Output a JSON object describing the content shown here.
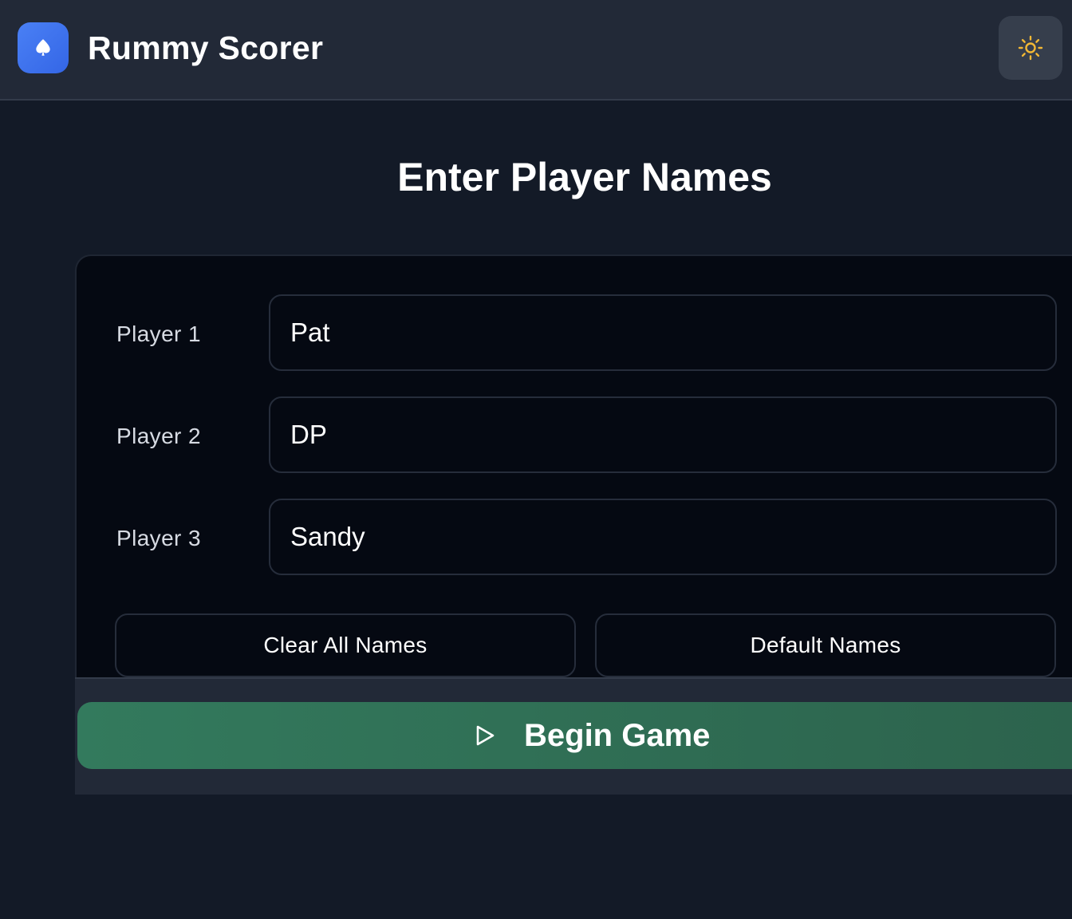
{
  "app": {
    "title": "Rummy Scorer",
    "logo_icon": "spade-icon",
    "theme_toggle_icon": "sun-icon"
  },
  "page": {
    "title": "Enter Player Names"
  },
  "players": [
    {
      "label": "Player 1",
      "value": "Pat"
    },
    {
      "label": "Player 2",
      "value": "DP"
    },
    {
      "label": "Player 3",
      "value": "Sandy"
    }
  ],
  "actions": {
    "clear_label": "Clear All Names",
    "default_label": "Default Names",
    "begin_label": "Begin Game",
    "begin_icon": "play-icon"
  },
  "colors": {
    "accent_blue": "#3b72f0",
    "sun_yellow": "#f2b835",
    "begin_green": "#337a5d",
    "background": "#131a27"
  }
}
